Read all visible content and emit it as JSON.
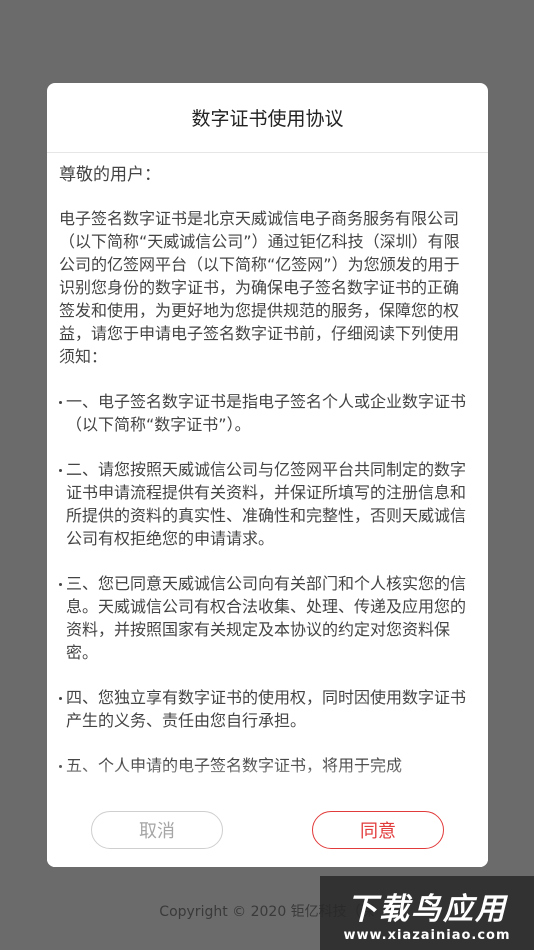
{
  "footer": {
    "copyright": "Copyright © 2020 钜亿科技（深"
  },
  "dialog": {
    "title": "数字证书使用协议",
    "greeting": "尊敬的用户：",
    "intro": "电子签名数字证书是北京天威诚信电子商务服务有限公司（以下简称“天威诚信公司”）通过钜亿科技（深圳）有限公司的亿签网平台（以下简称“亿签网”）为您颁发的用于识别您身份的数字证书，为确保电子签名数字证书的正确签发和使用，为更好地为您提供规范的服务，保障您的权益，请您于申请电子签名数字证书前，仔细阅读下列使用须知：",
    "clauses": [
      "一、电子签名数字证书是指电子签名个人或企业数字证书（以下简称“数字证书”）。",
      "二、请您按照天威诚信公司与亿签网平台共同制定的数字证书申请流程提供有关资料，并保证所填写的注册信息和所提供的资料的真实性、准确性和完整性，否则天威诚信公司有权拒绝您的申请请求。",
      "三、您已同意天威诚信公司向有关部门和个人核实您的信息。天威诚信公司有权合法收集、处理、传递及应用您的资料，并按照国家有关规定及本协议的约定对您资料保密。",
      "四、您独立享有数字证书的使用权，同时因使用数字证书产生的义务、责任由您自行承担。",
      "五、个人申请的电子签名数字证书，将用于完成"
    ],
    "cancel_label": "取消",
    "agree_label": "同意"
  },
  "watermark": {
    "text": "下载鸟应用",
    "url": "www.xiazainiao.com"
  },
  "colors": {
    "overlay": "#6b6b6b",
    "accent": "#e23b3b",
    "cancel_border": "#cfcfcf"
  }
}
